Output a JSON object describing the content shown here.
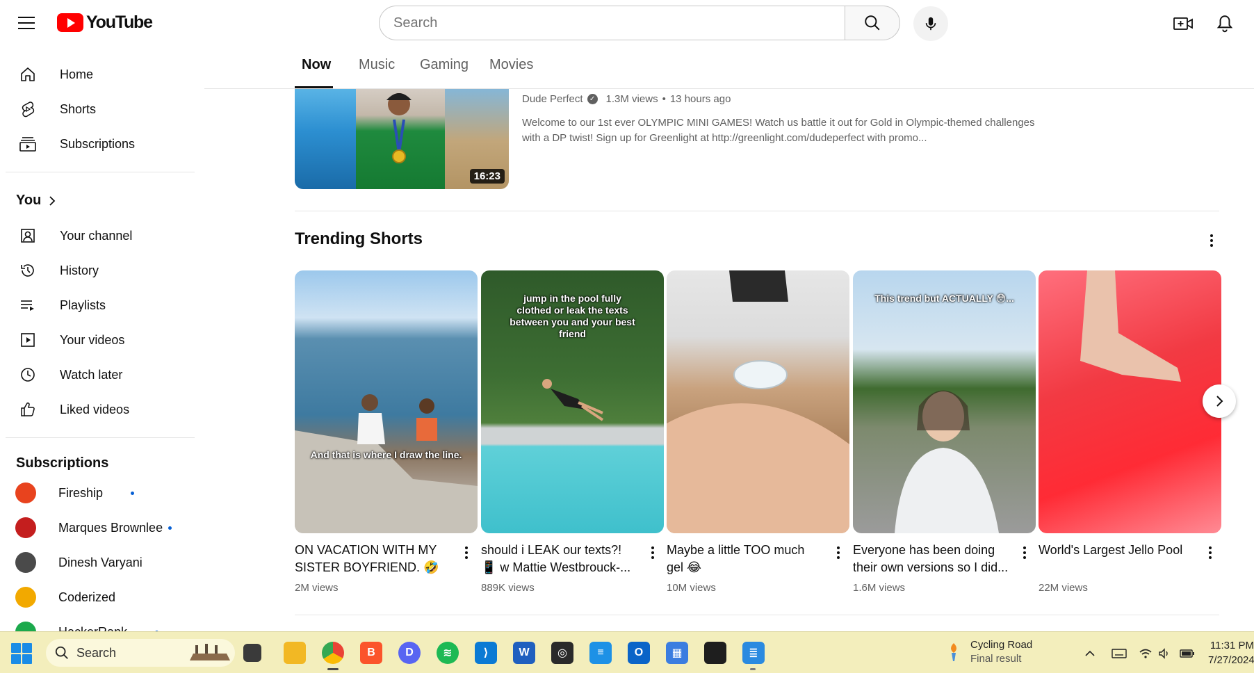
{
  "masthead": {
    "logo_text": "YouTube",
    "search_placeholder": "Search"
  },
  "sidebar": {
    "main_items": [
      {
        "label": "Home",
        "icon": "home-icon"
      },
      {
        "label": "Shorts",
        "icon": "shorts-icon"
      },
      {
        "label": "Subscriptions",
        "icon": "subscriptions-icon"
      }
    ],
    "you_heading": "You",
    "you_items": [
      {
        "label": "Your channel",
        "icon": "your-channel-icon"
      },
      {
        "label": "History",
        "icon": "history-icon"
      },
      {
        "label": "Playlists",
        "icon": "playlists-icon"
      },
      {
        "label": "Your videos",
        "icon": "your-videos-icon"
      },
      {
        "label": "Watch later",
        "icon": "watch-later-icon"
      },
      {
        "label": "Liked videos",
        "icon": "liked-videos-icon"
      }
    ],
    "subscriptions_heading": "Subscriptions",
    "subscriptions": [
      {
        "label": "Fireship",
        "new": true,
        "color": "#e8431e"
      },
      {
        "label": "Marques Brownlee",
        "new": true,
        "color": "#c41e1e"
      },
      {
        "label": "Dinesh Varyani",
        "new": false,
        "color": "#4a4a4a"
      },
      {
        "label": "Coderized",
        "new": false,
        "color": "#f2a900"
      },
      {
        "label": "HackerRank",
        "new": true,
        "color": "#1ba94c"
      }
    ]
  },
  "chips": [
    {
      "label": "Now",
      "active": true
    },
    {
      "label": "Music",
      "active": false
    },
    {
      "label": "Gaming",
      "active": false
    },
    {
      "label": "Movies",
      "active": false
    }
  ],
  "video": {
    "channel": "Dude Perfect",
    "views": "1.3M views",
    "age": "13 hours ago",
    "separator": "•",
    "description": "Welcome to our 1st ever OLYMPIC MINI GAMES! Watch us battle it out for Gold in Olympic-themed challenges with a DP twist! Sign up for Greenlight at http://greenlight.com/dudeperfect with promo...",
    "duration": "16:23"
  },
  "shelf": {
    "title": "Trending Shorts",
    "shorts": [
      {
        "title": "ON VACATION WITH MY SISTER BOYFRIEND. 🤣",
        "views": "2M views",
        "overlay": "And that is where I draw the line."
      },
      {
        "title": "should i LEAK our texts?! 📱 w Mattie Westbrouck-...",
        "views": "889K views",
        "overlay": "jump in the pool fully clothed or leak the texts between you and your best friend"
      },
      {
        "title": "Maybe a little TOO much gel 😂",
        "views": "10M views",
        "overlay": ""
      },
      {
        "title": "Everyone has been doing their own versions so I did...",
        "views": "1.6M views",
        "overlay": "This trend but ACTUALLY 😳..."
      },
      {
        "title": "World's Largest Jello Pool",
        "views": "22M views",
        "overlay": ""
      }
    ]
  },
  "taskbar": {
    "search_label": "Search",
    "weather_title": "Cycling Road",
    "weather_subtitle": "Final result",
    "time": "11:31 PM",
    "date": "7/27/2024",
    "apps": [
      "file-explorer-icon",
      "chrome-icon",
      "brave-icon",
      "discord-icon",
      "spotify-icon",
      "vscode-icon",
      "word-icon",
      "app-icon",
      "docker-icon",
      "outlook-icon",
      "calendar-icon",
      "sticky-notes-icon",
      "notepad-icon"
    ]
  }
}
